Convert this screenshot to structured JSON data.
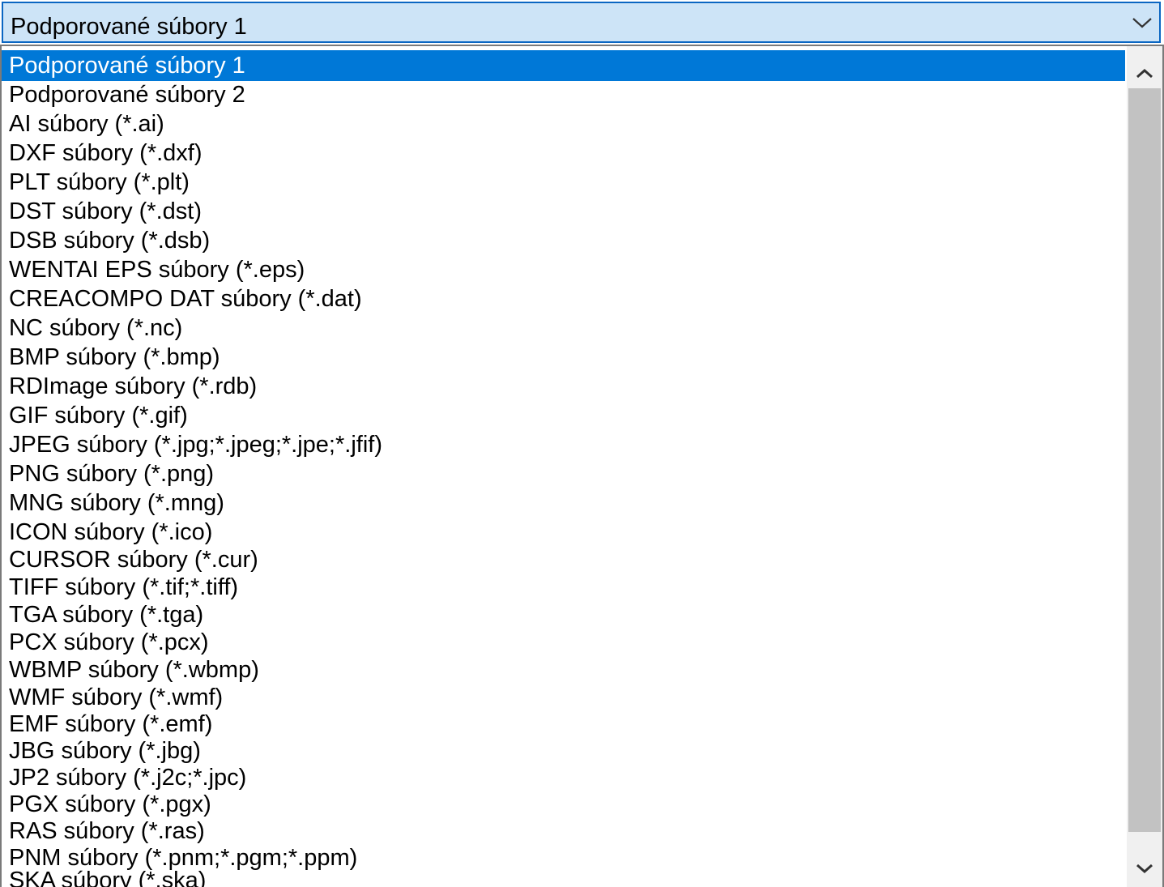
{
  "combo": {
    "value": "Podporované súbory 1",
    "arrow_icon": "chevron-down-icon"
  },
  "dropdown": {
    "selected_index": 0,
    "items": [
      "Podporované súbory 1",
      "Podporované súbory 2",
      "AI súbory (*.ai)",
      "DXF súbory (*.dxf)",
      "PLT súbory (*.plt)",
      "DST súbory (*.dst)",
      "DSB súbory (*.dsb)",
      "WENTAI EPS súbory (*.eps)",
      "CREACOMPO DAT súbory (*.dat)",
      "NC súbory (*.nc)",
      "BMP súbory (*.bmp)",
      "RDImage súbory (*.rdb)",
      "GIF súbory (*.gif)",
      "JPEG súbory (*.jpg;*.jpeg;*.jpe;*.jfif)",
      "PNG súbory (*.png)",
      "MNG súbory (*.mng)",
      "ICON súbory (*.ico)",
      "CURSOR súbory (*.cur)",
      "TIFF súbory (*.tif;*.tiff)",
      "TGA súbory (*.tga)",
      "PCX súbory (*.pcx)",
      "WBMP súbory (*.wbmp)",
      "WMF súbory (*.wmf)",
      "EMF súbory (*.emf)",
      "JBG súbory (*.jbg)",
      "JP2 súbory (*.j2c;*.jpc)",
      "PGX súbory (*.pgx)",
      "RAS súbory (*.ras)",
      "PNM súbory (*.pnm;*.pgm;*.ppm)",
      "SKA súbory (*.ska)"
    ]
  },
  "scrollbar": {
    "up_icon": "chevron-up-icon",
    "down_icon": "chevron-down-icon"
  },
  "colors": {
    "combo_border": "#0a66c2",
    "combo_background": "#cde4f7",
    "selection": "#0078d7",
    "scroll_thumb": "#c2c2c2",
    "scroll_track": "#f0f0f0"
  }
}
